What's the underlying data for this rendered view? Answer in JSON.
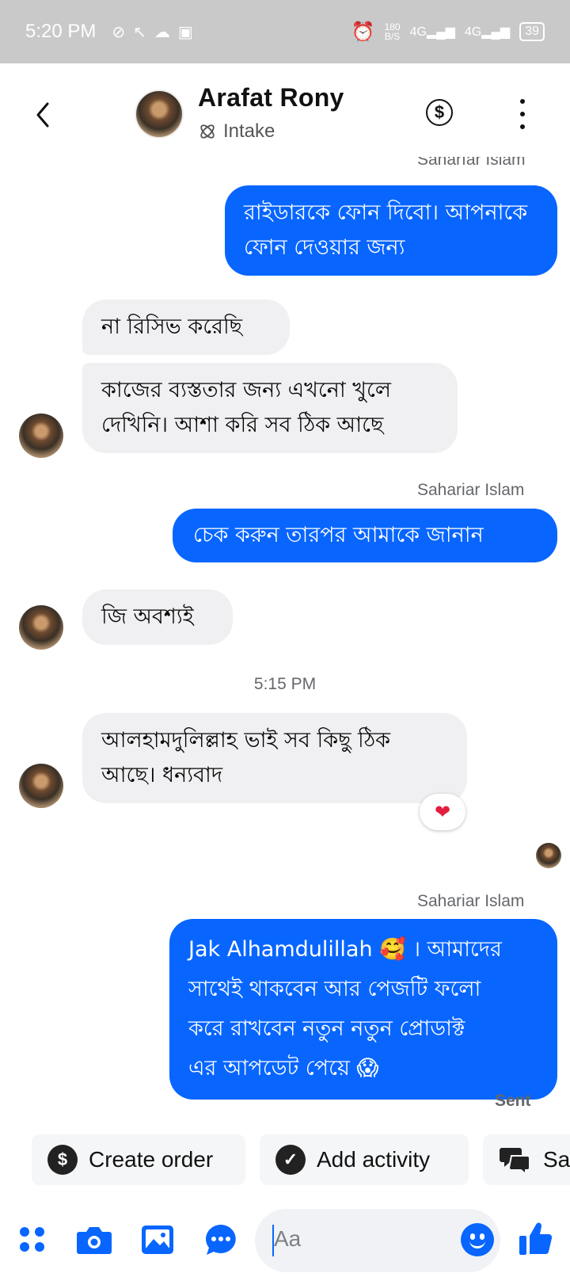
{
  "status_bar": {
    "time": "5:20 PM",
    "left_icons": [
      "dnd-icon",
      "phone-icon",
      "cloud-icon",
      "sim-icon"
    ],
    "net_speed_top": "180",
    "net_speed_bottom": "B/S",
    "signal1": "4G",
    "signal2": "4G",
    "battery": "39"
  },
  "header": {
    "contact_name": "Arafat Rony",
    "subtitle": "Intake"
  },
  "conversation": {
    "sender_label_cut": "Saharıar Islam",
    "msg1_out": "রাইডারকে ফোন দিবো। আপনাকে ফোন দেওয়ার জন্য",
    "msg2_in": "না রিসিভ করেছি",
    "msg3_in": "কাজের ব্যস্ততার জন্য এখনো খুলে দেখিনি। আশা করি সব ঠিক আছে",
    "sender_label_2": "Sahariar Islam",
    "msg4_out": "চেক করুন তারপর আমাকে জানান",
    "msg5_in": "জি অবশ্যই",
    "timestamp": "5:15 PM",
    "msg6_in": "আলহামদুলিল্লাহ ভাই সব কিছু ঠিক আছে। ধন্যবাদ",
    "msg6_reaction": "❤",
    "sender_label_3": "Sahariar Islam",
    "msg7_out_line1": "Jak Alhamdulillah 🥰 । আমাদের",
    "msg7_out_line2": "সাথেই থাকবেন আর পেজটি ফলো",
    "msg7_out_line3": "করে রাখবেন নতুন নতুন প্রোডাক্ট",
    "msg7_out_line4": "এর আপডেট পেয়ে 😱",
    "status": "Sent"
  },
  "quick_actions": [
    {
      "label": "Create order",
      "icon": "$"
    },
    {
      "label": "Add activity",
      "icon": "✓"
    },
    {
      "label": "Sa",
      "icon": "saved-replies-icon"
    }
  ],
  "composer": {
    "placeholder": "Aa",
    "accent": "#0866ff"
  },
  "colors": {
    "outgoing_bubble": "#0866ff",
    "incoming_bubble": "#f0f0f2",
    "status_bar": "#c9c9c9"
  }
}
